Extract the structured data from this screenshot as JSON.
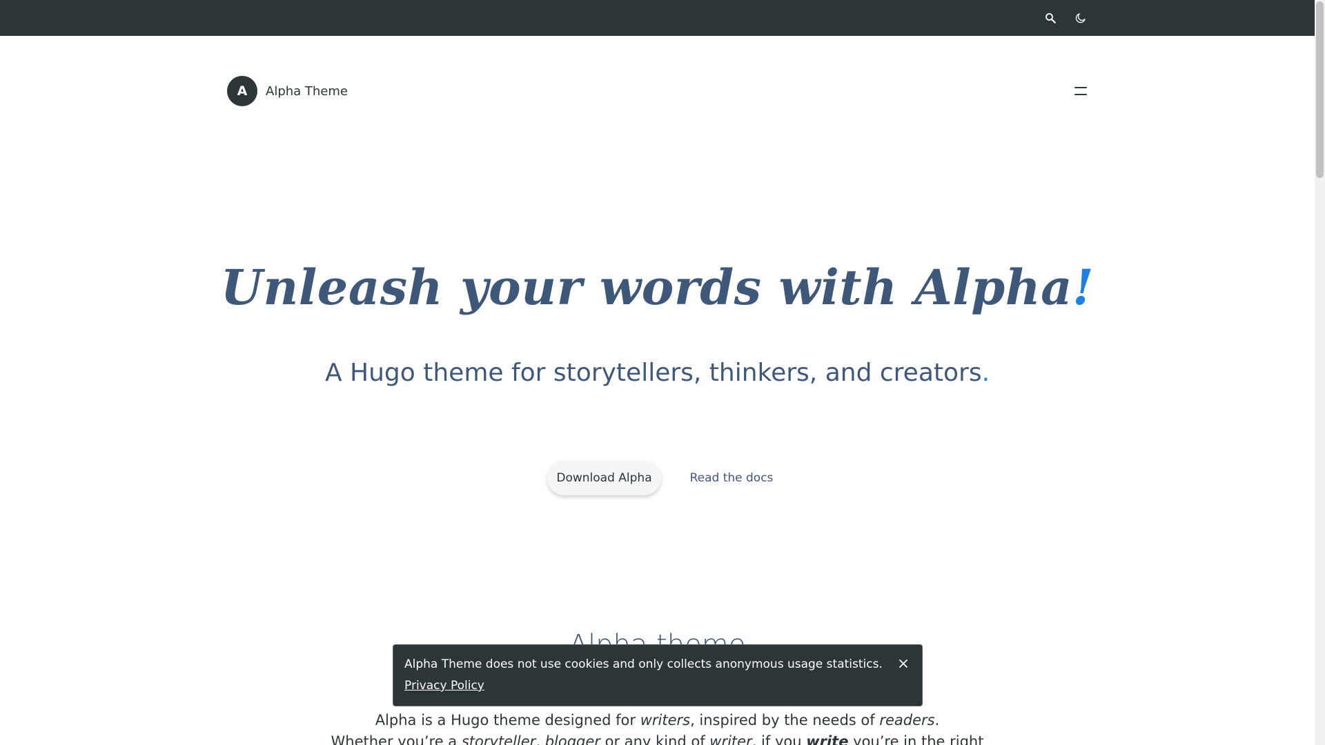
{
  "topbar": {
    "search_icon": "search-icon",
    "theme_icon": "moon-icon"
  },
  "brand": {
    "logo_letter": "A",
    "name": "Alpha Theme"
  },
  "menu_icon": "menu-icon",
  "hero": {
    "title_main": "Unleash your words with Alpha",
    "title_accent": "!",
    "subtitle_main": "A Hugo theme for storytellers, thinkers, and creators",
    "subtitle_accent": ".",
    "primary_cta": "Download Alpha",
    "secondary_cta": "Read the docs"
  },
  "section": {
    "title": "Alpha theme",
    "intro_line1": {
      "a": "Alpha is a Hugo theme designed for ",
      "b": "writers",
      "c": ", inspired by the needs of ",
      "d": "readers",
      "e": "."
    },
    "intro_line2": {
      "a": "Whether you’re a ",
      "b": "storyteller",
      "c": ", ",
      "d": "blogger",
      "e": " or any kind of ",
      "f": "writer",
      "g": ", if you ",
      "h": "write",
      "i": " you’re in the right"
    }
  },
  "cookie_banner": {
    "message": "Alpha Theme does not use cookies and only collects anonymous usage statistics.",
    "link": "Privacy Policy",
    "close_icon": "close-icon"
  },
  "colors": {
    "topbar_bg": "#2c3538",
    "accent": "#1d7fe0",
    "heading": "#3f587a"
  }
}
